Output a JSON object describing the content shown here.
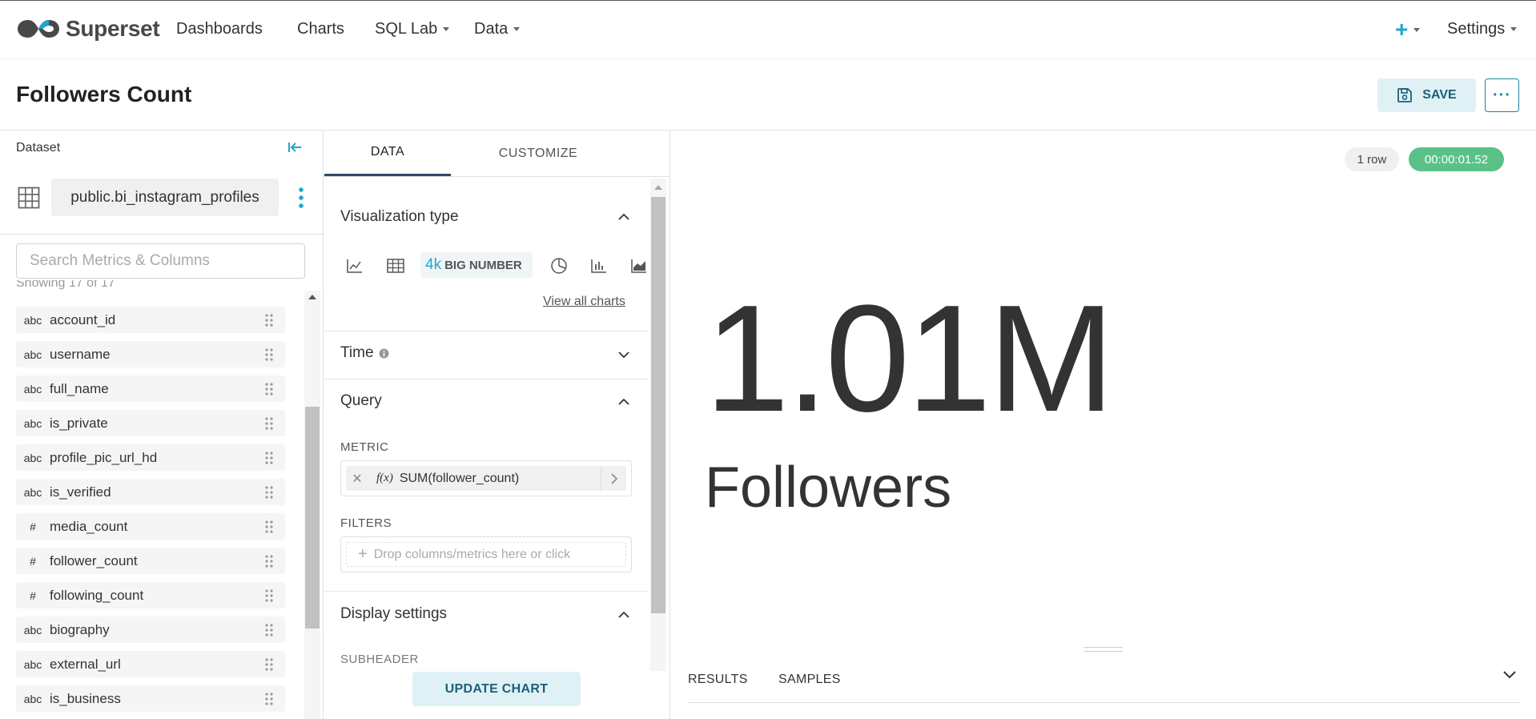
{
  "app": {
    "name": "Superset"
  },
  "nav": {
    "items": [
      "Dashboards",
      "Charts",
      "SQL Lab",
      "Data"
    ],
    "plus": "+",
    "settings": "Settings"
  },
  "header": {
    "title": "Followers Count",
    "save_label": "SAVE",
    "more_label": "···"
  },
  "dataset": {
    "label": "Dataset",
    "name": "public.bi_instagram_profiles",
    "search_placeholder": "Search Metrics & Columns",
    "showing": "Showing 17 of 17",
    "columns": [
      {
        "type": "abc",
        "name": "account_id"
      },
      {
        "type": "abc",
        "name": "username"
      },
      {
        "type": "abc",
        "name": "full_name"
      },
      {
        "type": "abc",
        "name": "is_private"
      },
      {
        "type": "abc",
        "name": "profile_pic_url_hd"
      },
      {
        "type": "abc",
        "name": "is_verified"
      },
      {
        "type": "#",
        "name": "media_count"
      },
      {
        "type": "#",
        "name": "follower_count"
      },
      {
        "type": "#",
        "name": "following_count"
      },
      {
        "type": "abc",
        "name": "biography"
      },
      {
        "type": "abc",
        "name": "external_url"
      },
      {
        "type": "abc",
        "name": "is_business"
      }
    ]
  },
  "controls": {
    "tabs": [
      "DATA",
      "CUSTOMIZE"
    ],
    "viz_type_title": "Visualization type",
    "viz_active": {
      "num": "4k",
      "label": "BIG NUMBER"
    },
    "view_all": "View all charts",
    "time_title": "Time",
    "query_title": "Query",
    "metric_label": "METRIC",
    "metric_value": "SUM(follower_count)",
    "metric_fx": "f(x)",
    "filters_label": "FILTERS",
    "filters_placeholder": "Drop columns/metrics here or click",
    "display_title": "Display settings",
    "subheader_label": "SUBHEADER",
    "update_label": "UPDATE CHART"
  },
  "chart": {
    "rows": "1 row",
    "time": "00:00:01.52",
    "big_number": "1.01M",
    "subheader": "Followers",
    "tabs": [
      "RESULTS",
      "SAMPLES"
    ]
  },
  "colors": {
    "accent": "#20a7c9",
    "success": "#5ac189",
    "primary_dark": "#1a5f78"
  }
}
